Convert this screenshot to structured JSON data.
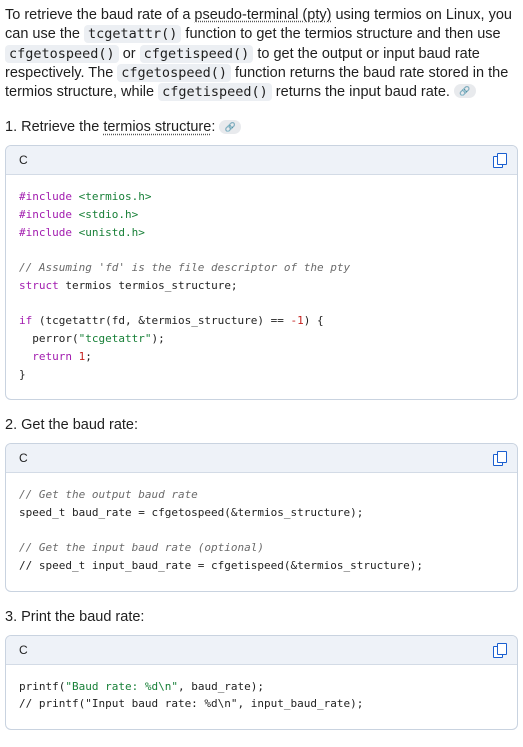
{
  "intro": {
    "t1": "To retrieve the baud rate of a ",
    "term1": "pseudo-terminal (pty)",
    "t2": " using termios on Linux, you can use the ",
    "c1": "tcgetattr()",
    "t3": " function to get the termios structure and then use ",
    "c2": "cfgetospeed()",
    "t4": " or ",
    "c3": "cfgetispeed()",
    "t5": " to get the output or input baud rate respectively. The ",
    "c4": "cfgetospeed()",
    "t6": " function returns the baud rate stored in the termios structure, while ",
    "c5": "cfgetispeed()",
    "t7": " returns the input baud rate. ",
    "chip": "🔗"
  },
  "steps": [
    {
      "prefix": "1. Retrieve the ",
      "term": "termios structure",
      "suffix": ":",
      "chip": "🔗"
    },
    {
      "text": "2. Get the baud rate:"
    },
    {
      "text": "3. Print the baud rate:"
    }
  ],
  "blocks": [
    {
      "lang": "C",
      "copy_icon": "copy-icon"
    },
    {
      "lang": "C",
      "copy_icon": "copy-icon"
    },
    {
      "lang": "C",
      "copy_icon": "copy-icon"
    }
  ],
  "code": {
    "b1": {
      "inc1": "#include",
      "h1": "<termios.h>",
      "inc2": "#include",
      "h2": "<stdio.h>",
      "inc3": "#include",
      "h3": "<unistd.h>",
      "com1": "// Assuming 'fd' is the file descriptor of the pty",
      "struct_kw": "struct",
      "struct_rest": " termios termios_structure;",
      "if_kw": "if",
      "if_rest1": " (tcgetattr(fd, &termios_structure) == ",
      "if_num": "-1",
      "if_rest2": ") {",
      "perror1": "  perror(",
      "perror_str": "\"tcgetattr\"",
      "perror2": ");",
      "ret_kw": "  return",
      "ret_sp": " ",
      "ret_num": "1",
      "ret_end": ";",
      "close": "}"
    },
    "b2": {
      "com1": "// Get the output baud rate",
      "l1": "speed_t baud_rate = cfgetospeed(&termios_structure);",
      "com2": "// Get the input baud rate (optional)",
      "l2": "// speed_t input_baud_rate = cfgetispeed(&termios_structure);"
    },
    "b3": {
      "p1a": "printf(",
      "p1s": "\"Baud rate: %d\\n\"",
      "p1b": ", baud_rate);",
      "l2": "// printf(\"Input baud rate: %d\\n\", input_baud_rate);"
    }
  }
}
